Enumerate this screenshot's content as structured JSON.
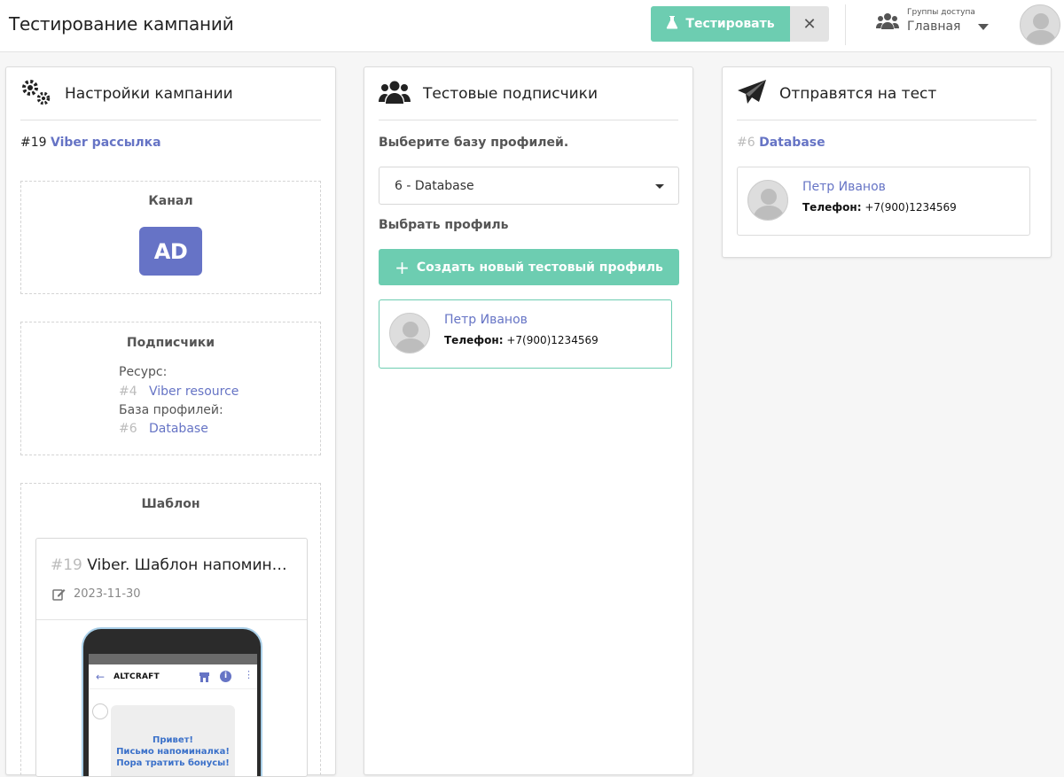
{
  "header": {
    "title": "Тестирование кампаний",
    "test_button": "Тестировать",
    "close_button": "✕",
    "access_groups_caption": "Группы доступа",
    "access_group_value": "Главная"
  },
  "settings": {
    "title": "Настройки кампании",
    "campaign_id": "#19",
    "campaign_name": "Viber рассылка",
    "channel_title": "Канал",
    "channel_badge": "AD",
    "subscribers_title": "Подписчики",
    "resource_label": "Ресурс:",
    "resource_id": "#4",
    "resource_name": "Viber resource",
    "db_label": "База профилей:",
    "db_id": "#6",
    "db_name": "Database",
    "template_title": "Шаблон",
    "template": {
      "id": "#19",
      "name": "Viber. Шаблон напомин…",
      "date": "2023-11-30",
      "phone_brand": "ALTCRAFT",
      "message_line1": "Привет!",
      "message_line2": "Письмо напоминалка!",
      "message_line3": "Пора тратить бонусы!"
    }
  },
  "subscribers": {
    "title": "Тестовые подписчики",
    "select_db_label": "Выберите базу профилей.",
    "selected_db": "6 - Database",
    "select_profile_label": "Выбрать профиль",
    "create_button": "Создать новый тестовый профиль",
    "profile_name": "Петр Иванов",
    "phone_label": "Телефон:",
    "phone_value": "+7(900)1234569"
  },
  "send": {
    "title": "Отправятся на тест",
    "db_id": "#6",
    "db_name": "Database",
    "profile_name": "Петр Иванов",
    "phone_label": "Телефон:",
    "phone_value": "+7(900)1234569"
  },
  "colors": {
    "accent_green": "#6dcdb1",
    "link_blue": "#6674c5",
    "badge_purple": "#6673c6"
  }
}
